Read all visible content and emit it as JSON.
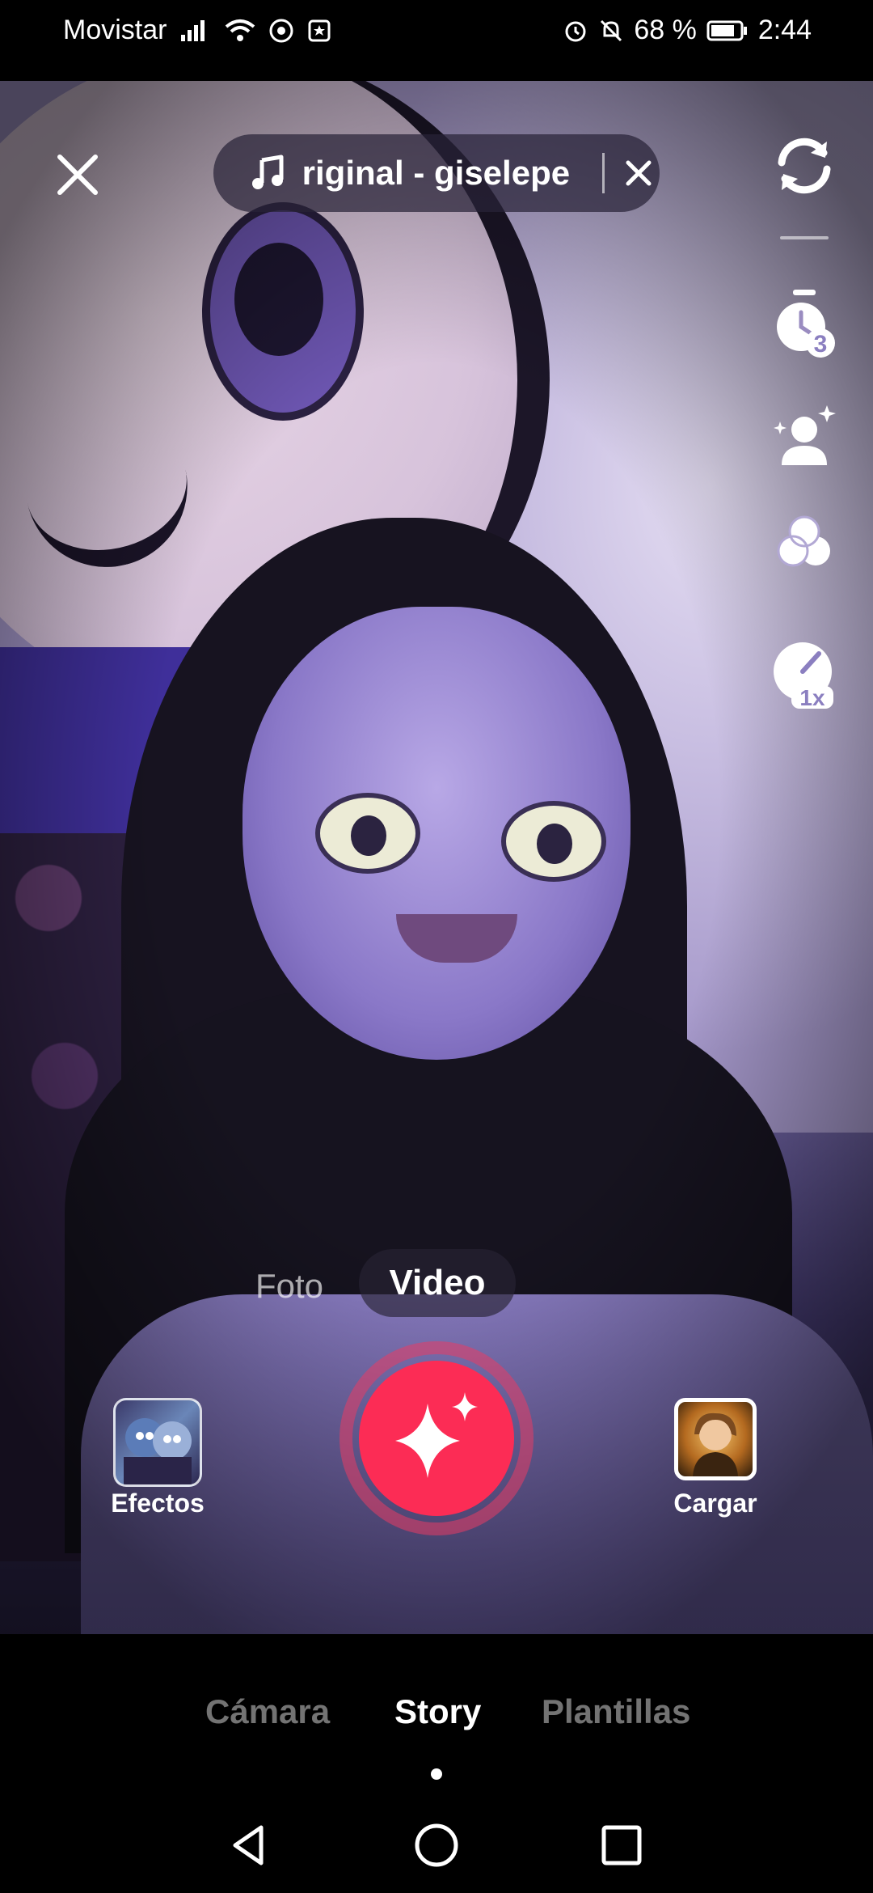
{
  "status_bar": {
    "carrier": "Movistar",
    "battery_percent": "68 %",
    "time": "2:44",
    "icons": [
      "signal-icon",
      "wifi-icon",
      "whatsapp-icon",
      "notification-icon",
      "alarm-icon",
      "mute-icon",
      "battery-icon"
    ]
  },
  "top_bar": {
    "sound_title": "riginal - giselepe",
    "icons": [
      "close-icon",
      "music-note-icon",
      "remove-sound-icon"
    ]
  },
  "right_tools": {
    "icons": [
      "flip-camera-icon",
      "timer-icon",
      "beauty-icon",
      "filters-icon",
      "speed-icon"
    ],
    "timer_value": "3",
    "speed_value": "1x"
  },
  "modes": {
    "foto": "Foto",
    "video": "Video",
    "selected": "Video"
  },
  "record_row": {
    "effects_label": "Efectos",
    "upload_label": "Cargar",
    "record_icon": "sparkle-icon"
  },
  "tabs": {
    "items": [
      "Cámara",
      "Story",
      "Plantillas"
    ],
    "selected": "Story"
  },
  "colors": {
    "record": "#fc2c55",
    "record_ring": "#e83c64"
  },
  "nav": {
    "icons": [
      "back-icon",
      "home-icon",
      "recents-icon"
    ]
  }
}
